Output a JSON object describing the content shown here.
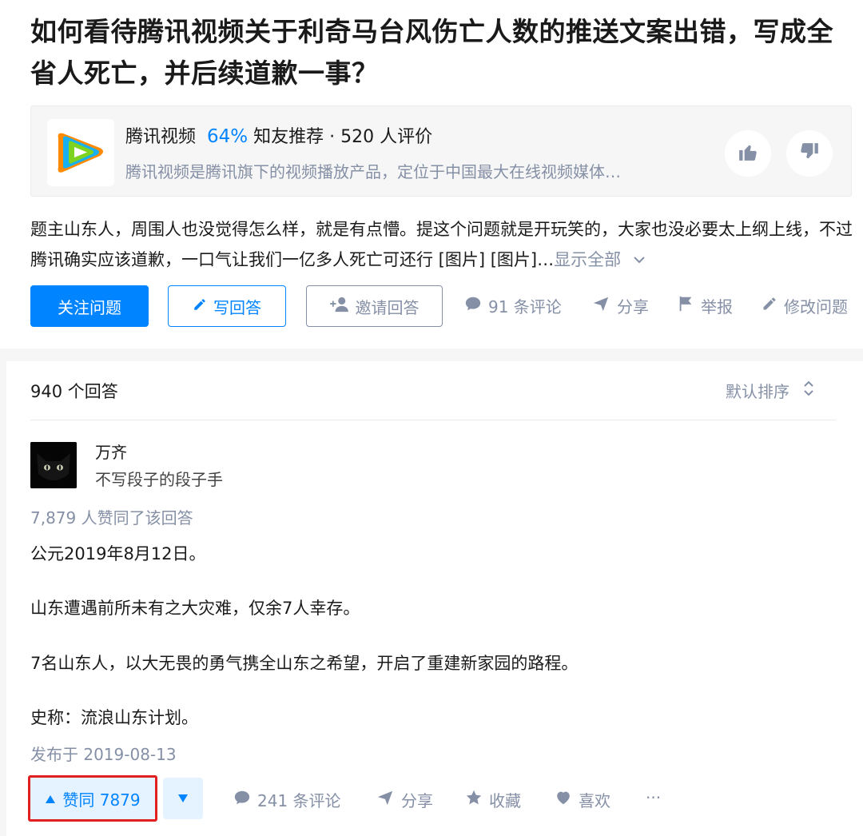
{
  "question": {
    "title": "如何看待腾讯视频关于利奇马台风伤亡人数的推送文案出错，写成全省人死亡，并后续道歉一事？",
    "detail": "题主山东人，周围人也没觉得怎么样，就是有点懵。提这个问题就是开玩笑的，大家也没必要太上纲上线，不过腾讯确实应该道歉，一口气让我们一亿多人死亡可还行 [图片] [图片]…",
    "show_all": "显示全部"
  },
  "topic": {
    "name": "腾讯视频",
    "percent": "64%",
    "recommend": "知友推荐",
    "dot": "·",
    "rating_count": "520 人评价",
    "description": "腾讯视频是腾讯旗下的视频播放产品，定位于中国最大在线视频媒体…"
  },
  "buttons": {
    "follow": "关注问题",
    "write": "写回答",
    "invite": "邀请回答"
  },
  "question_actions": {
    "comments": "91 条评论",
    "share": "分享",
    "report": "举报",
    "edit": "修改问题"
  },
  "answers": {
    "count": "940 个回答",
    "sort": "默认排序"
  },
  "answer": {
    "author_name": "万齐",
    "author_bio": "不写段子的段子手",
    "upvote_info": "7,879 人赞同了该回答",
    "paragraphs": [
      "公元2019年8月12日。",
      "山东遭遇前所未有之大灾难，仅余7人幸存。",
      "7名山东人，以大无畏的勇气携全山东之希望，开启了重建新家园的路程。",
      "史称：流浪山东计划。"
    ],
    "publish_date": "发布于 2019-08-13",
    "agree_label": "赞同 7879",
    "comments": "241 条评论",
    "share": "分享",
    "collect": "收藏",
    "like": "喜欢",
    "more": "···"
  },
  "colors": {
    "brand_blue": "#0084ff",
    "muted": "#8590a6",
    "highlight_red": "#e02020"
  },
  "icons": [
    "thumb-up-icon",
    "thumb-down-icon",
    "pencil-icon",
    "add-user-icon",
    "comment-icon",
    "share-icon",
    "flag-icon",
    "sort-icon",
    "triangle-up-icon",
    "triangle-down-icon",
    "star-icon",
    "heart-icon",
    "more-icon"
  ]
}
